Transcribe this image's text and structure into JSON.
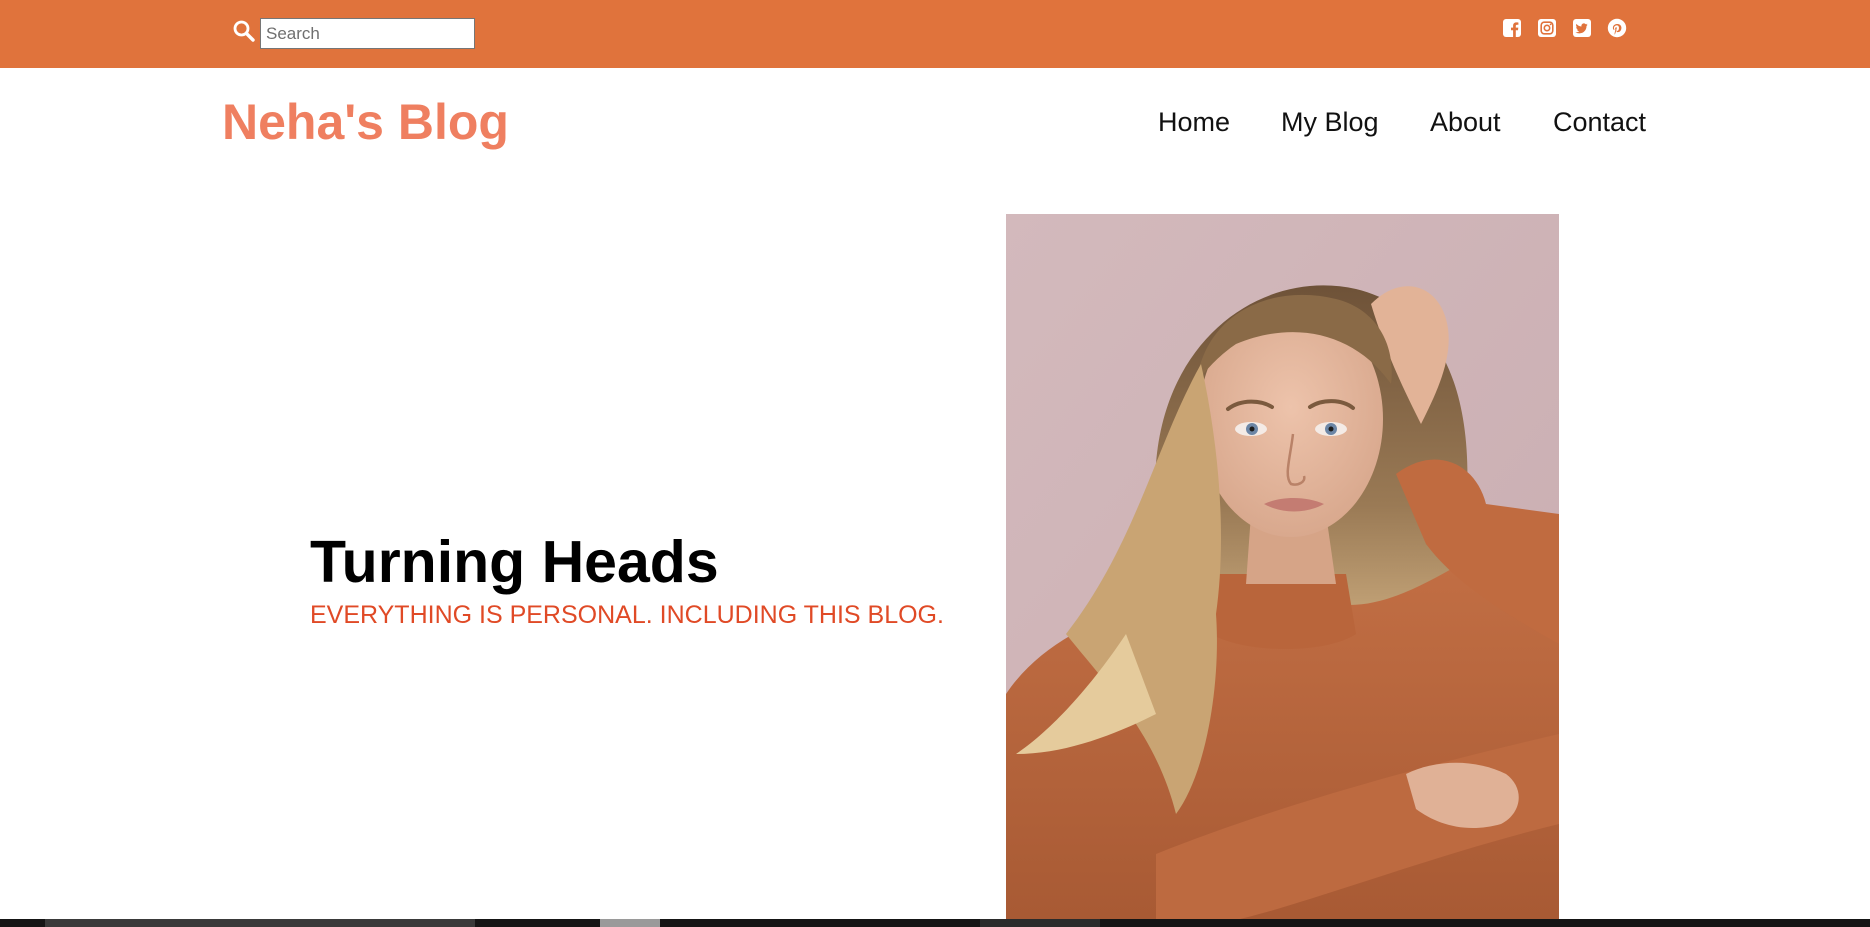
{
  "topbar": {
    "background": "#e0733c",
    "search": {
      "icon": "search-icon",
      "placeholder": "Search",
      "value": ""
    },
    "social_links": [
      {
        "name": "facebook",
        "icon": "facebook-square-icon"
      },
      {
        "name": "instagram",
        "icon": "instagram-icon"
      },
      {
        "name": "twitter",
        "icon": "twitter-square-icon"
      },
      {
        "name": "pinterest",
        "icon": "pinterest-icon"
      }
    ]
  },
  "header": {
    "site_title": "Neha's Blog",
    "title_color": "#ef7f60",
    "nav": [
      {
        "label": "Home"
      },
      {
        "label": "My Blog"
      },
      {
        "label": "About"
      },
      {
        "label": "Contact"
      }
    ]
  },
  "hero": {
    "heading": "Turning Heads",
    "tagline": "EVERYTHING IS PERSONAL. INCLUDING THIS BLOG.",
    "tagline_color": "#e04a26",
    "image": "portrait-photo"
  }
}
